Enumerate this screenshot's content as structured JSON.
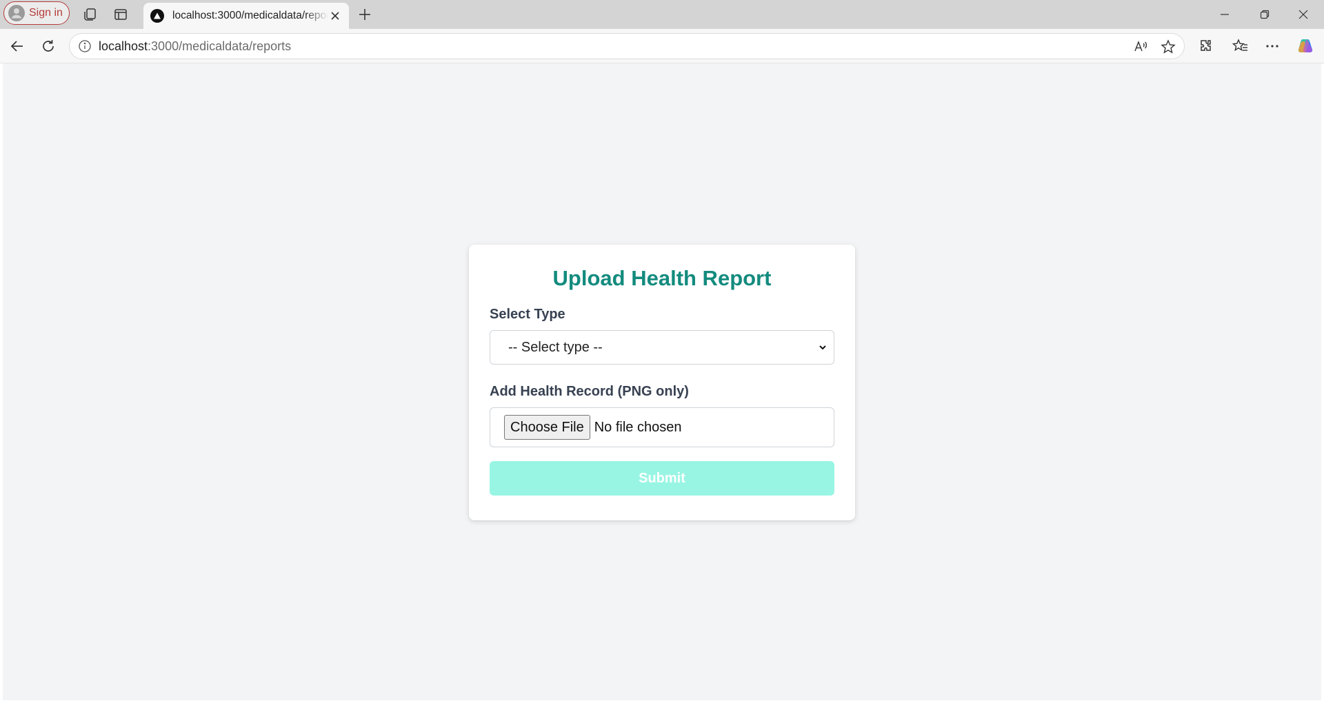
{
  "browser": {
    "signin_label": "Sign in",
    "tab_title": "localhost:3000/medicaldata/reports",
    "url_host": "localhost",
    "url_rest": ":3000/medicaldata/reports"
  },
  "form": {
    "title": "Upload Health Report",
    "type_label": "Select Type",
    "type_selected": "-- Select type --",
    "file_label": "Add Health Record (PNG only)",
    "file_button": "Choose File",
    "file_status": "No file chosen",
    "submit_label": "Submit"
  },
  "colors": {
    "title": "#138b7e",
    "submit_bg": "#99f5e3",
    "page_bg": "#f3f4f6"
  }
}
